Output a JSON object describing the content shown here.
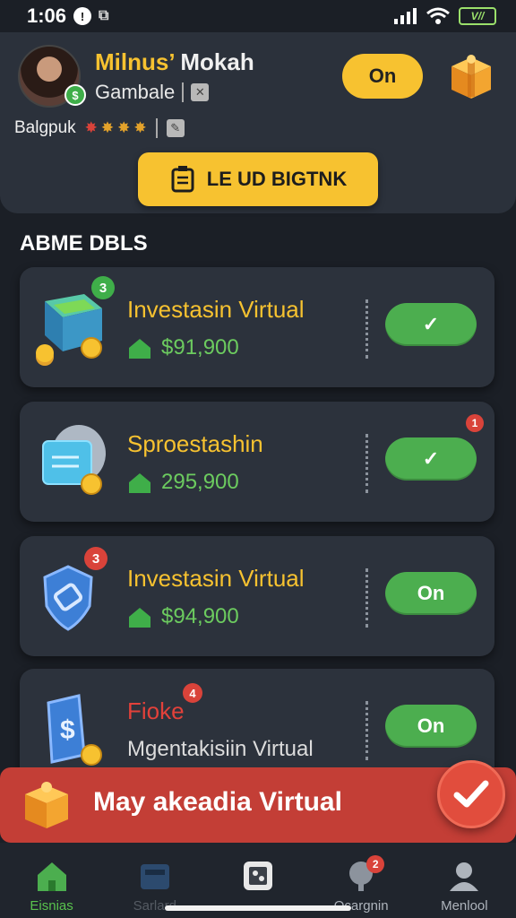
{
  "status_bar": {
    "time": "1:06",
    "battery_label": "V//"
  },
  "profile": {
    "first_name": "Milnus’",
    "last_name": "Mokah",
    "subtitle": "Gambale",
    "rating_label": "Balgpuk",
    "toggle_label": "On"
  },
  "cta": {
    "label": "LE UD BIGTNK"
  },
  "section": {
    "title": "ABME DBLS"
  },
  "cards": [
    {
      "title": "Investasin Virtual",
      "amount": "$91,900",
      "badge": "3",
      "toggle": "✓"
    },
    {
      "title": "Sproestashin",
      "amount": "295,900",
      "badge": "1",
      "toggle": "✓"
    },
    {
      "title": "Investasin Virtual",
      "amount": "$94,900",
      "badge": "3",
      "toggle": "On"
    },
    {
      "title": "Fioke",
      "subtitle": "Mgentakisiin Virtual",
      "badge": "4",
      "toggle": "On"
    }
  ],
  "promo": {
    "label": "May akeadia Virtual"
  },
  "nav": [
    {
      "label": "Eisnias"
    },
    {
      "label": "Sarlard"
    },
    {
      "label": ""
    },
    {
      "label": "Ocargnin",
      "badge": "2"
    },
    {
      "label": "Menlool"
    }
  ],
  "colors": {
    "accent": "#f7c230",
    "success": "#4cae4f",
    "danger": "#c33e36",
    "background": "#1b1f26",
    "card": "#2c323c"
  }
}
